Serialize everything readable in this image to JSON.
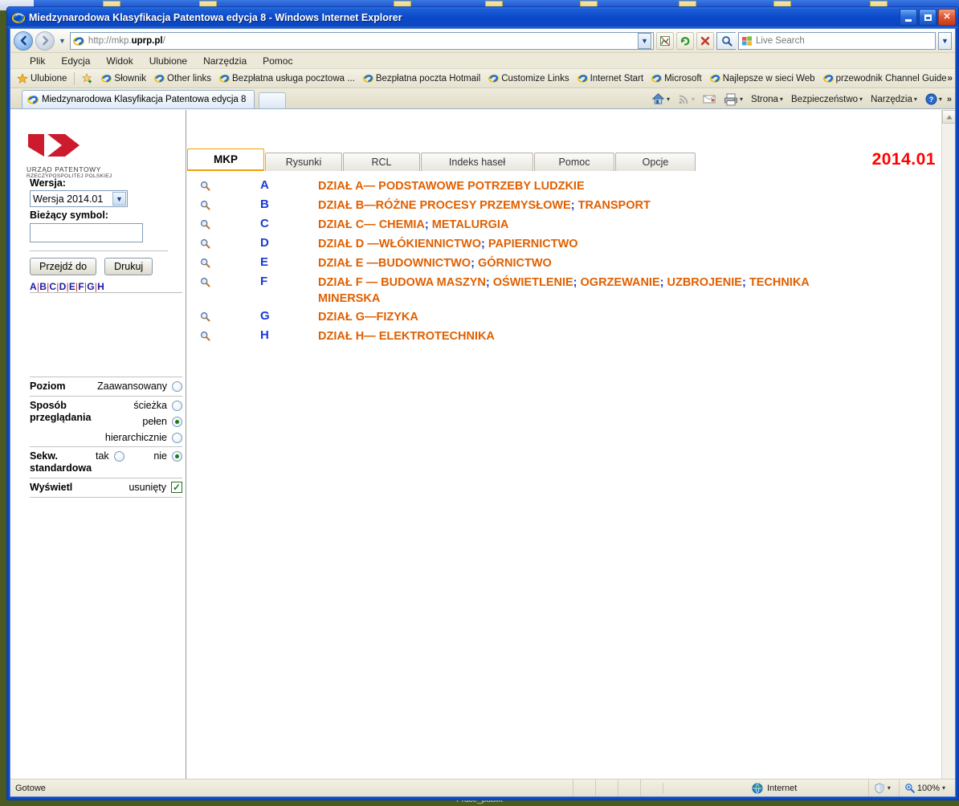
{
  "window": {
    "title": "Miedzynarodowa Klasyfikacja Patentowa edycja 8 - Windows Internet Explorer",
    "app_icon": "ie-logo-icon",
    "minimize_label": "Minimalizuj",
    "maximize_label": "Maksymalizuj",
    "close_label": "Zamknij"
  },
  "nav": {
    "back_label": "←",
    "forward_label": "→",
    "history_caret": "▼",
    "address_prefix": "http://mkp.",
    "address_bold": "uprp.pl",
    "address_suffix": "/",
    "address_dropdown": "▼",
    "compat_icon": "compatibility-view-icon",
    "refresh_icon": "↻",
    "stop_icon": "✕",
    "search_placeholder": "Live Search",
    "search_value": "",
    "search_go_icon": "magnifier-icon",
    "search_drop": "▼"
  },
  "menubar": {
    "items": [
      "Plik",
      "Edycja",
      "Widok",
      "Ulubione",
      "Narzędzia",
      "Pomoc"
    ]
  },
  "favbar": {
    "favorites_label": "Ulubione",
    "star_icon": "star-icon",
    "add_icon": "add-favorite-icon",
    "links": [
      "Słownik",
      "Other links",
      "Bezpłatna usługa pocztowa ...",
      "Bezpłatna poczta Hotmail",
      "Customize Links",
      "Internet Start",
      "Microsoft",
      "Najlepsze w sieci Web",
      "przewodnik Channel Guide"
    ],
    "overflow": "»"
  },
  "tabstrip": {
    "tab_label": "Miedzynarodowa Klasyfikacja Patentowa edycja 8",
    "tab_icon": "ie-logo-icon",
    "new_tab_label": "",
    "tools": [
      {
        "name": "home",
        "icon": "home-icon",
        "label": "",
        "caret": "▾"
      },
      {
        "name": "feeds",
        "icon": "rss-icon",
        "label": "",
        "caret": "▾"
      },
      {
        "name": "mail",
        "icon": "mail-icon",
        "label": "",
        "caret": ""
      },
      {
        "name": "print",
        "icon": "printer-icon",
        "label": "",
        "caret": "▾"
      },
      {
        "name": "page",
        "icon": "",
        "label": "Strona",
        "caret": "▾"
      },
      {
        "name": "safety",
        "icon": "",
        "label": "Bezpieczeństwo",
        "caret": "▾"
      },
      {
        "name": "tools",
        "icon": "",
        "label": "Narzędzia",
        "caret": "▾"
      },
      {
        "name": "help",
        "icon": "help-icon",
        "label": "",
        "caret": "▾"
      }
    ],
    "overflow": "»"
  },
  "sidebar": {
    "logo_line1": "URZĄD PATENTOWY",
    "logo_line2": "RZECZYPOSPOLITEJ POLSKIEJ",
    "version_label": "Wersja:",
    "version_value": "Wersja 2014.01",
    "version_caret": "▼",
    "symbol_label": "Bieżący symbol:",
    "symbol_value": "",
    "goto_button": "Przejdź do",
    "print_button": "Drukuj",
    "letters": [
      "A",
      "B",
      "C",
      "D",
      "E",
      "F",
      "G",
      "H"
    ],
    "letter_separator": "|",
    "options": [
      {
        "name": "Poziom",
        "values": [
          {
            "label": "Zaawansowany",
            "selected": false
          }
        ]
      },
      {
        "name": "Sposób przeglądania",
        "values": [
          {
            "label": "ścieżka",
            "selected": false
          },
          {
            "label": "pełen",
            "selected": true
          },
          {
            "label": "hierarchicznie",
            "selected": false
          }
        ]
      },
      {
        "name": "Sekw. standardowa",
        "values": [
          {
            "label": "tak",
            "selected": false
          },
          {
            "label": "nie",
            "selected": true
          }
        ]
      },
      {
        "name": "Wyświetl",
        "values": [
          {
            "label": "usunięty",
            "checked": true
          }
        ]
      }
    ]
  },
  "main": {
    "tabs": [
      {
        "label": "MKP",
        "active": true
      },
      {
        "label": "Rysunki",
        "active": false
      },
      {
        "label": "RCL",
        "active": false
      },
      {
        "label": "Indeks haseł",
        "active": false
      },
      {
        "label": "Pomoc",
        "active": false
      },
      {
        "label": "Opcje",
        "active": false
      }
    ],
    "version_badge": "2014.01",
    "row_icon": "magnifier-icon",
    "rows": [
      {
        "letter": "A",
        "title": "DZIAŁ A— PODSTAWOWE POTRZEBY LUDZKIE"
      },
      {
        "letter": "B",
        "title": "DZIAŁ B—RÓŻNE PROCESY PRZEMYSŁOWE; TRANSPORT"
      },
      {
        "letter": "C",
        "title": "DZIAŁ C— CHEMIA; METALURGIA"
      },
      {
        "letter": "D",
        "title": "DZIAŁ D —WŁÓKIENNICTWO; PAPIERNICTWO"
      },
      {
        "letter": "E",
        "title": "DZIAŁ E —BUDOWNICTWO; GÓRNICTWO"
      },
      {
        "letter": "F",
        "title": "DZIAŁ F — BUDOWA MASZYN; OŚWIETLENIE; OGRZEWANIE; UZBROJENIE; TECHNIKA MINERSKA"
      },
      {
        "letter": "G",
        "title": "DZIAŁ G—FIZYKA"
      },
      {
        "letter": "H",
        "title": "DZIAŁ H— ELEKTROTECHNIKA"
      }
    ],
    "scroll_up": "▲",
    "scroll_down": "▼"
  },
  "statusbar": {
    "status": "Gotowe",
    "zone_icon": "globe-icon",
    "zone": "Internet",
    "protected_icon": "shield-icon",
    "protected_caret": "▾",
    "zoom_icon": "zoom-icon",
    "zoom": "100%",
    "zoom_caret": "▾"
  },
  "desktop": {
    "bottom_caption": "Prace_publik"
  },
  "colors": {
    "accent_orange": "#e06000",
    "link_blue": "#1a3ad6",
    "version_red": "#ff0000",
    "title_blue": "#0a46c8"
  }
}
